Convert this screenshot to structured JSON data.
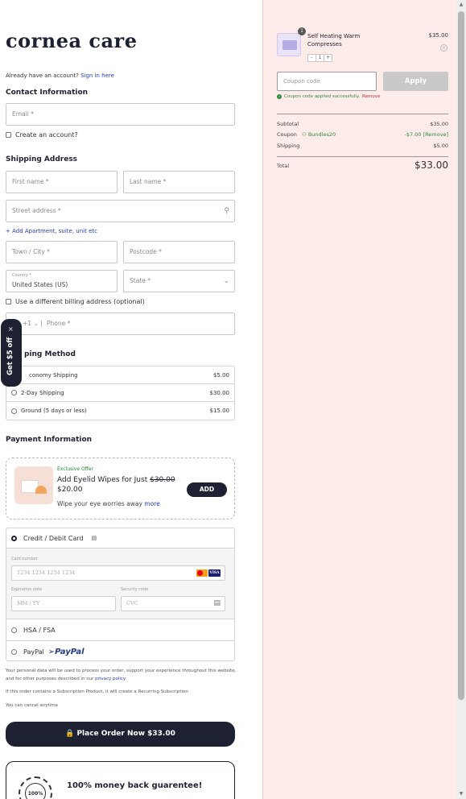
{
  "brand": {
    "logo": "cornea care"
  },
  "account": {
    "prompt": "Already have an account?",
    "signin": "Sign in here"
  },
  "contact": {
    "heading": "Contact Information",
    "email_placeholder": "Email *",
    "create_account": "Create an account?"
  },
  "shipping": {
    "heading": "Shipping Address",
    "first_name": "First name *",
    "last_name": "Last name *",
    "street": "Street address *",
    "add_apartment": "+ Add Apartment, suite, unit etc",
    "town": "Town / City *",
    "postcode": "Postcode *",
    "country_label": "Country *",
    "country_value": "United States (US)",
    "state": "State *",
    "different_billing": "Use a different billing address (optional)",
    "phone_code": "+1",
    "phone": "Phone *"
  },
  "promo_tab": {
    "label": "Get $5 off",
    "close": "×"
  },
  "shipping_method": {
    "heading": "Shipping Method",
    "heading_visible": "ping Method",
    "options": [
      {
        "label": "Economy Shipping",
        "label_visible": "conomy Shipping",
        "price": "$5.00",
        "selected": true
      },
      {
        "label": "2-Day Shipping",
        "price": "$30.00",
        "selected": false
      },
      {
        "label": "Ground (5 days or less)",
        "price": "$15.00",
        "selected": false
      }
    ]
  },
  "payment": {
    "heading": "Payment Information",
    "offer": {
      "tag": "Exclusive Offer",
      "title": "Add Eyelid Wipes for Just",
      "old_price": "$30.00",
      "new_price": "$20.00",
      "subtitle": "Wipe your eye worries away",
      "more": "more",
      "add_button": "ADD"
    },
    "methods": {
      "card_label": "Credit / Debit Card",
      "card_number_label": "Card number",
      "card_number_placeholder": "1234 1234 1234 1234",
      "expiry_label": "Expiration date",
      "expiry_placeholder": "MM / YY",
      "cvc_label": "Security code",
      "cvc_placeholder": "CVC",
      "hsa": "HSA / FSA",
      "paypal": "PayPal",
      "paypal_logo": "PayPal",
      "visa": "VISA"
    }
  },
  "legal": {
    "privacy_text": "Your personal data will be used to process your order, support your experience throughout this website, and for other purposes described in our",
    "privacy_link": "privacy policy",
    "subscription": "If this order contains a Subscription Product, it will create a Recurring Subscription",
    "cancel": "You can cancel anytime"
  },
  "place_order": {
    "label": "Place Order Now  $33.00"
  },
  "guarantee": {
    "title": "100% money back guarentee!",
    "seal": "100%"
  },
  "summary": {
    "product": {
      "name": "Self Heating Warm Compresses",
      "price": "$35.00",
      "qty": "1",
      "badge": "1"
    },
    "coupon_placeholder": "Coupon code",
    "apply": "Apply",
    "coupon_msg": "Coupon code applied successfully.",
    "coupon_remove": "Remove",
    "subtotal_label": "Subtotal",
    "subtotal": "$35.00",
    "coupon_label": "Coupon",
    "coupon_code": "Bundles20",
    "coupon_discount": "-$7.00",
    "coupon_remove_bracket": "[Remove]",
    "shipping_label": "Shipping",
    "shipping": "$5.00",
    "total_label": "Total",
    "total": "$33.00"
  }
}
